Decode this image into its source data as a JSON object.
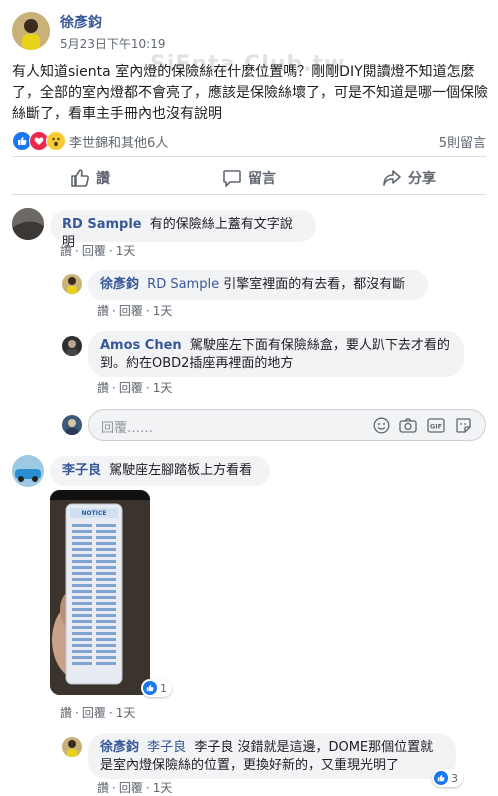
{
  "post": {
    "author": "徐彥鈞",
    "timestamp": "5月23日下午10:19",
    "body": "有人知道sienta 室內燈的保險絲在什麼位置嗎？剛剛DIY閱讀燈不知道怎麼了，全部的室內燈都不會亮了，應該是保險絲壞了，可是不知道是哪一個保險絲斷了，看車主手冊內也沒有說明",
    "reactions_text": "李世錦和其他6人",
    "comment_count": "5則留言",
    "watermark": "SiEnta Club.tw"
  },
  "actions": {
    "like": "讚",
    "comment": "留言",
    "share": "分享"
  },
  "meta_labels": {
    "like": "讚",
    "reply": "回覆",
    "dot": "·"
  },
  "comments": [
    {
      "author": "RD Sample",
      "text": "有的保險絲上蓋有文字說明",
      "time": "1天"
    },
    {
      "author": "徐彥鈞",
      "mention": "RD Sample",
      "text": "引擎室裡面的有去看，都沒有斷",
      "time": "1天"
    },
    {
      "author": "Amos Chen",
      "text": "駕駛座左下面有保險絲盒，要人趴下去才看的到。約在OBD2插座再裡面的地方",
      "time": "1天"
    },
    {
      "author": "李子良",
      "text": "駕駛座左腳踏板上方看看",
      "time": "1天",
      "image_like_count": "1"
    },
    {
      "author": "徐彥鈞",
      "mention": "李子良",
      "text": "李子良 沒錯就是這邊，DOME那個位置就是室內燈保險絲的位置，更換好新的，又重現光明了",
      "time": "1天",
      "like_count": "3"
    }
  ],
  "reply_box": {
    "placeholder": "回覆……"
  },
  "photo": {
    "label": "NOTICE"
  },
  "colors": {
    "link": "#385898",
    "like_blue": "#1877f2",
    "bubble": "#f2f3f5"
  }
}
